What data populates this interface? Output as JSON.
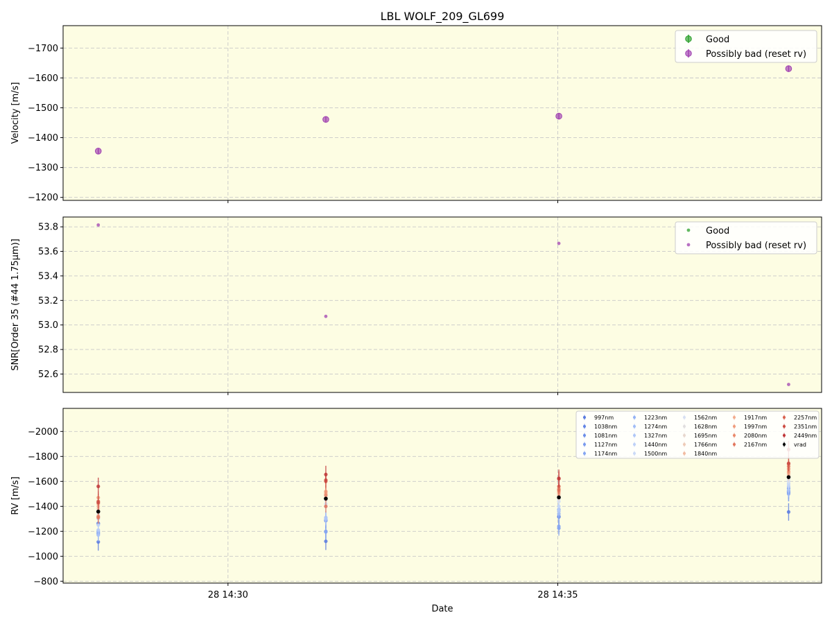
{
  "figure": {
    "title": "LBL WOLF_209_GL699",
    "xlabel": "Date",
    "x_ticks": [
      {
        "value": "2024-xx-28 14:30",
        "label": "28 14:30"
      },
      {
        "value": "2024-xx-28 14:35",
        "label": "28 14:35"
      }
    ]
  },
  "chart_data": [
    {
      "type": "scatter",
      "panel": "velocity",
      "ylabel": "Velocity [m/s]",
      "xlim": [
        "28 14:27:30",
        "28 14:39:00"
      ],
      "ylim": [
        -1775,
        -1190
      ],
      "y_inverted": true,
      "y_ticks": [
        -1200,
        -1300,
        -1400,
        -1500,
        -1600,
        -1700
      ],
      "grid": true,
      "legend": {
        "placement": "top-right",
        "entries": [
          "Good",
          "Possibly bad (reset rv)"
        ]
      },
      "series": [
        {
          "name": "Good",
          "color": "#2ca02c",
          "points": []
        },
        {
          "name": "Possibly bad (reset rv)",
          "color": "#a040b0",
          "points": [
            {
              "x": "28 14:28:02",
              "y": -1355,
              "err": 8
            },
            {
              "x": "28 14:31:29",
              "y": -1461,
              "err": 8
            },
            {
              "x": "28 14:35:01",
              "y": -1472,
              "err": 8
            },
            {
              "x": "28 14:38:30",
              "y": -1631,
              "err": 8
            }
          ]
        }
      ]
    },
    {
      "type": "scatter",
      "panel": "snr",
      "ylabel": "SNR[Order 35 (#44 1.75μm)]",
      "xlim": [
        "28 14:27:30",
        "28 14:39:00"
      ],
      "ylim": [
        52.45,
        53.88
      ],
      "y_ticks": [
        52.6,
        52.8,
        53.0,
        53.2,
        53.4,
        53.6,
        53.8
      ],
      "grid": true,
      "legend": {
        "placement": "top-right",
        "entries": [
          "Good",
          "Possibly bad (reset rv)"
        ]
      },
      "series": [
        {
          "name": "Good",
          "color": "#2ca02c",
          "points": []
        },
        {
          "name": "Possibly bad (reset rv)",
          "color": "#a040b0",
          "points": [
            {
              "x": "28 14:28:02",
              "y": 53.815
            },
            {
              "x": "28 14:31:29",
              "y": 53.07
            },
            {
              "x": "28 14:35:01",
              "y": 53.665
            },
            {
              "x": "28 14:38:30",
              "y": 52.515
            }
          ]
        }
      ]
    },
    {
      "type": "scatter",
      "panel": "rv",
      "ylabel": "RV [m/s]",
      "xlim": [
        "28 14:27:30",
        "28 14:39:00"
      ],
      "ylim": [
        -2185,
        -785
      ],
      "y_inverted": true,
      "y_ticks": [
        -800,
        -1000,
        -1200,
        -1400,
        -1600,
        -1800,
        -2000
      ],
      "grid": true,
      "legend": {
        "placement": "top-right",
        "columns": 5
      },
      "times": [
        "28 14:28:02",
        "28 14:31:29",
        "28 14:35:01",
        "28 14:38:30"
      ],
      "series": [
        {
          "name": "997nm",
          "color": "#5a7be0",
          "values": [
            -1115,
            -1120,
            -1315,
            -1355
          ],
          "err": 70
        },
        {
          "name": "1038nm",
          "color": "#6385e6",
          "values": [
            -1260,
            -1290,
            -1375,
            -1510
          ],
          "err": 70
        },
        {
          "name": "1081nm",
          "color": "#6c8ee9",
          "values": [
            -1265,
            -1285,
            -1320,
            -1520
          ],
          "err": 60
        },
        {
          "name": "1127nm",
          "color": "#7a9bee",
          "values": [
            -1180,
            -1200,
            -1225,
            -1545
          ],
          "err": 60
        },
        {
          "name": "1174nm",
          "color": "#86a6f2",
          "values": [
            -1190,
            -1195,
            -1240,
            -1500
          ],
          "err": 60
        },
        {
          "name": "1223nm",
          "color": "#94b2f5",
          "values": [
            -1200,
            -1290,
            -1340,
            -1520
          ],
          "err": 50
        },
        {
          "name": "1274nm",
          "color": "#a2bdf7",
          "values": [
            -1170,
            -1310,
            -1360,
            -1530
          ],
          "err": 50
        },
        {
          "name": "1327nm",
          "color": "#b0c7f8",
          "values": [
            -1210,
            -1300,
            -1375,
            -1560
          ],
          "err": 50
        },
        {
          "name": "1440nm",
          "color": "#bed1f8",
          "values": [
            -1250,
            -1400,
            -1400,
            -1580
          ],
          "err": 50
        },
        {
          "name": "1500nm",
          "color": "#cbdaf7",
          "values": [
            -1300,
            -1420,
            -1440,
            -1600
          ],
          "err": 50
        },
        {
          "name": "1562nm",
          "color": "#d8e0f2",
          "values": [
            -1320,
            -1450,
            -1460,
            -1620
          ],
          "err": 40
        },
        {
          "name": "1628nm",
          "color": "#e2dfe0",
          "values": [
            -1340,
            -1460,
            -1470,
            -1630
          ],
          "err": 40
        },
        {
          "name": "1695nm",
          "color": "#e8d8cf",
          "values": [
            -1360,
            -1480,
            -1480,
            -1640
          ],
          "err": 40
        },
        {
          "name": "1766nm",
          "color": "#eecbb8",
          "values": [
            -1380,
            -1490,
            -1490,
            -1650
          ],
          "err": 40
        },
        {
          "name": "1840nm",
          "color": "#f2bca3",
          "values": [
            -1400,
            -1500,
            -1500,
            -1660
          ],
          "err": 40
        },
        {
          "name": "1917nm",
          "color": "#f3ad8f",
          "values": [
            -1420,
            -1510,
            -1510,
            -1670
          ],
          "err": 40
        },
        {
          "name": "1997nm",
          "color": "#f09d7e",
          "values": [
            -1470,
            -1520,
            -1520,
            -1680
          ],
          "err": 50
        },
        {
          "name": "2080nm",
          "color": "#ea8a6d",
          "values": [
            -1320,
            -1490,
            -1540,
            -1700
          ],
          "err": 50
        },
        {
          "name": "2167nm",
          "color": "#e2775e",
          "values": [
            -1310,
            -1400,
            -1530,
            -1720
          ],
          "err": 50
        },
        {
          "name": "2257nm",
          "color": "#d96350",
          "values": [
            -1440,
            -1600,
            -1560,
            -1740
          ],
          "err": 60
        },
        {
          "name": "2351nm",
          "color": "#cd4e44",
          "values": [
            -1430,
            -1610,
            -1620,
            -1745
          ],
          "err": 60
        },
        {
          "name": "2449nm",
          "color": "#c0383a",
          "values": [
            -1560,
            -1655,
            -1625,
            -1855
          ],
          "err": 70
        },
        {
          "name": "vrad",
          "color": "#000000",
          "values": [
            -1358,
            -1462,
            -1472,
            -1634
          ],
          "err": 8
        }
      ]
    }
  ]
}
